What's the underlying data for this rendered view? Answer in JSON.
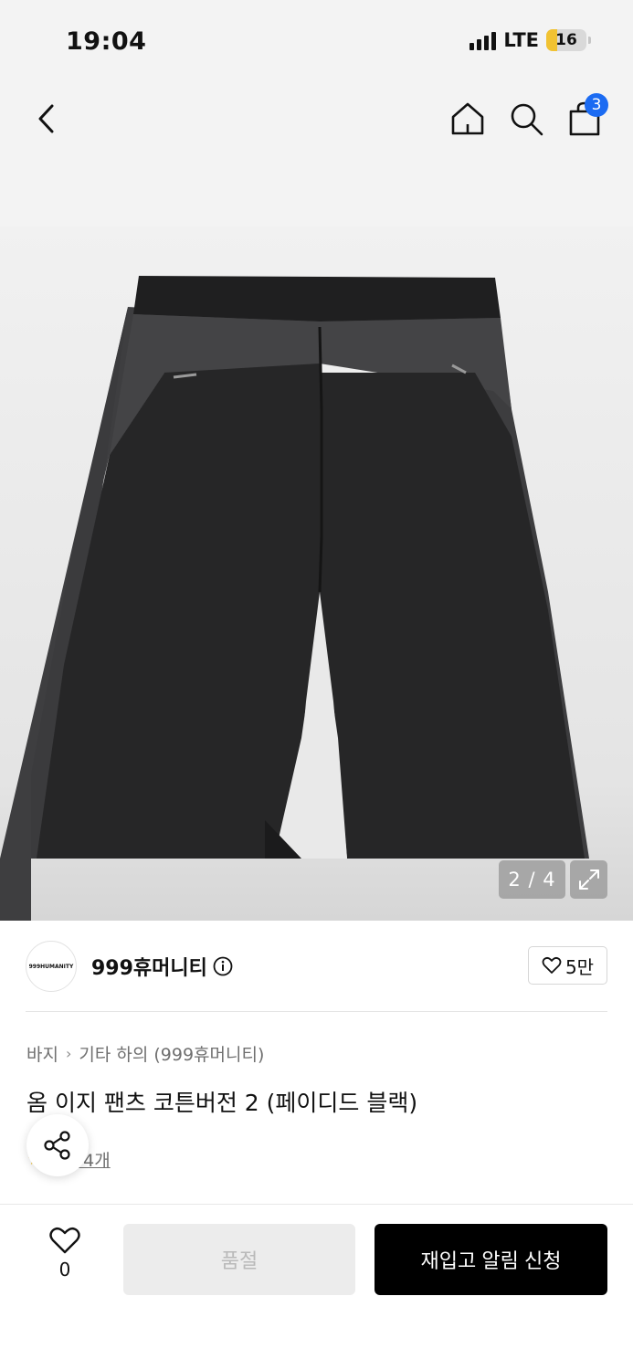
{
  "status_bar": {
    "time": "19:04",
    "network": "LTE",
    "battery": "16"
  },
  "nav": {
    "cart_count": "3"
  },
  "image": {
    "page_indicator": "2 / 4"
  },
  "brand": {
    "logo_text": "999HUMANITY",
    "name": "999휴머니티",
    "like_count": "5만"
  },
  "breadcrumb": {
    "category": "바지",
    "subcategory": "기타 하의 (999휴머니티)"
  },
  "product": {
    "title": "옴 이지 팬츠 코튼버전 2 (페이디드 블랙)",
    "review_text": "후기 4개"
  },
  "bottom_bar": {
    "wish_count": "0",
    "soldout_label": "품절",
    "restock_label": "재입고 알림 신청"
  },
  "colors": {
    "accent_badge": "#1b6bf2",
    "battery_fill": "#f1c232",
    "primary_button": "#000000"
  }
}
